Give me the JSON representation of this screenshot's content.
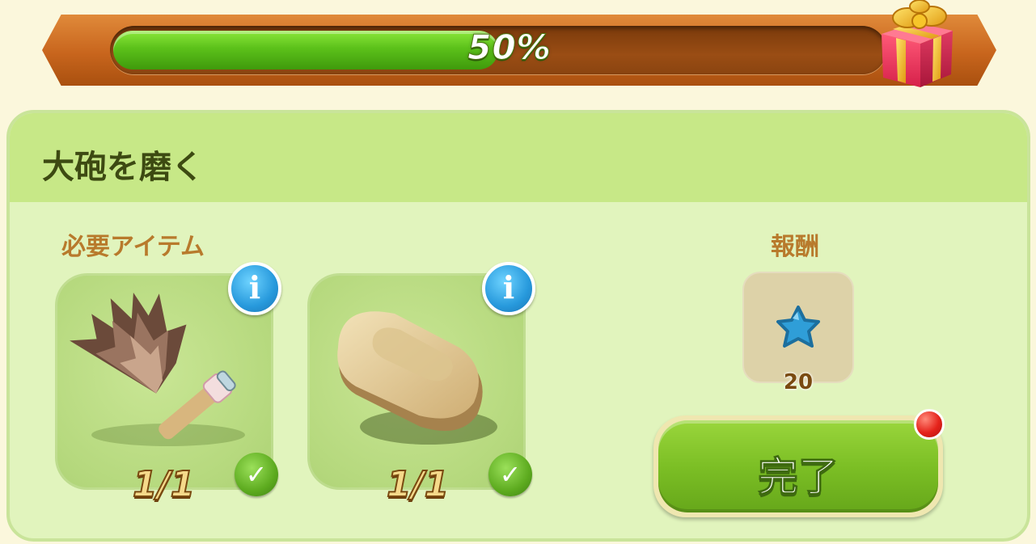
{
  "progress": {
    "percent_label": "50%",
    "fraction": 0.5,
    "reward_icon": "gift-box-icon"
  },
  "quest": {
    "title": "大砲を磨く",
    "required_label": "必要アイテム",
    "reward_label": "報酬",
    "items": [
      {
        "icon": "feather-duster-icon",
        "count": "1/1",
        "complete": true
      },
      {
        "icon": "soap-bar-icon",
        "count": "1/1",
        "complete": true
      }
    ],
    "reward": {
      "icon": "blue-star-icon",
      "amount": "20"
    },
    "complete_button_label": "完了"
  },
  "colors": {
    "progress_fill": "#5cc11a",
    "panel_bg": "#e1f4bd",
    "header_bg": "#c7e887",
    "label_brown": "#b87a2c",
    "button_green": "#7cbf25"
  }
}
